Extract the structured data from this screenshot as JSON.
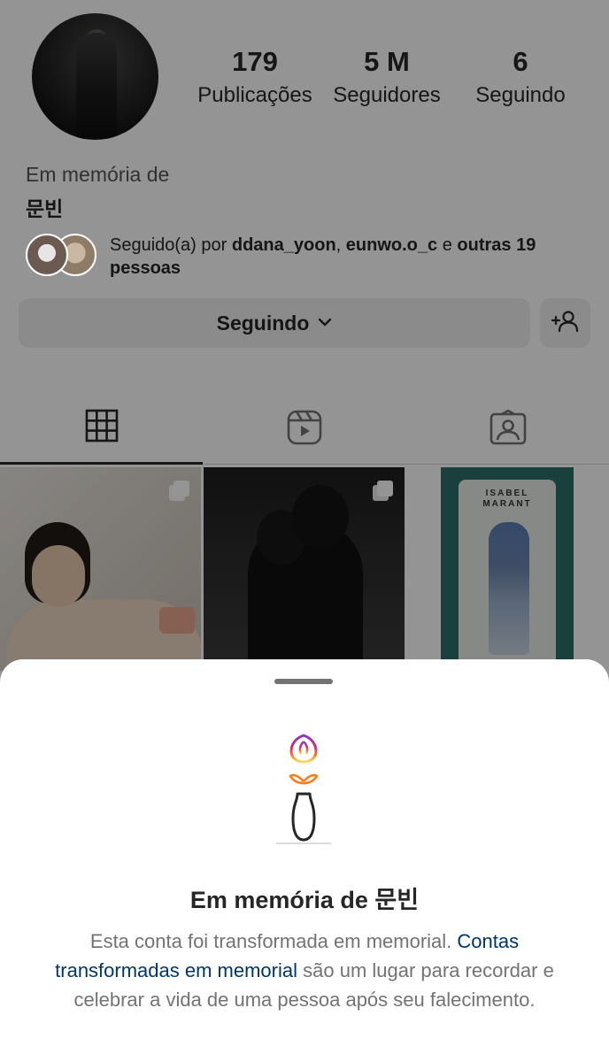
{
  "profile": {
    "stats": [
      {
        "value": "179",
        "label": "Publicações"
      },
      {
        "value": "5 M",
        "label": "Seguidores"
      },
      {
        "value": "6",
        "label": "Seguindo"
      }
    ],
    "bio_memorial": "Em memória de",
    "bio_name": "문빈",
    "followed_by": {
      "prefix": "Seguido(a) por ",
      "user1": "ddana_yoon",
      "sep": ", ",
      "user2": "eunwo.o_c",
      "and": " e ",
      "others": "outras 19 pessoas"
    },
    "follow_button": {
      "label": "Seguindo",
      "chevron": "⌄"
    },
    "add_friend_icon": "person-plus-icon"
  },
  "tabs": [
    {
      "name": "grid",
      "icon": "grid-icon"
    },
    {
      "name": "reels",
      "icon": "reels-icon"
    },
    {
      "name": "tagged",
      "icon": "tagged-icon"
    }
  ],
  "posts": {
    "post3_sign": "ISABEL MARANT"
  },
  "sheet": {
    "title": "Em memória de 문빈",
    "body_part1": "Esta conta foi transformada em memorial. ",
    "body_link": "Contas transformadas em memorial",
    "body_part2": " são um lugar para recordar e celebrar a vida de uma pessoa após seu falecimento."
  },
  "colors": {
    "link": "#00376b",
    "text": "#262626",
    "secondary": "#737373",
    "overlay": "rgba(0,0,0,0.42)"
  }
}
